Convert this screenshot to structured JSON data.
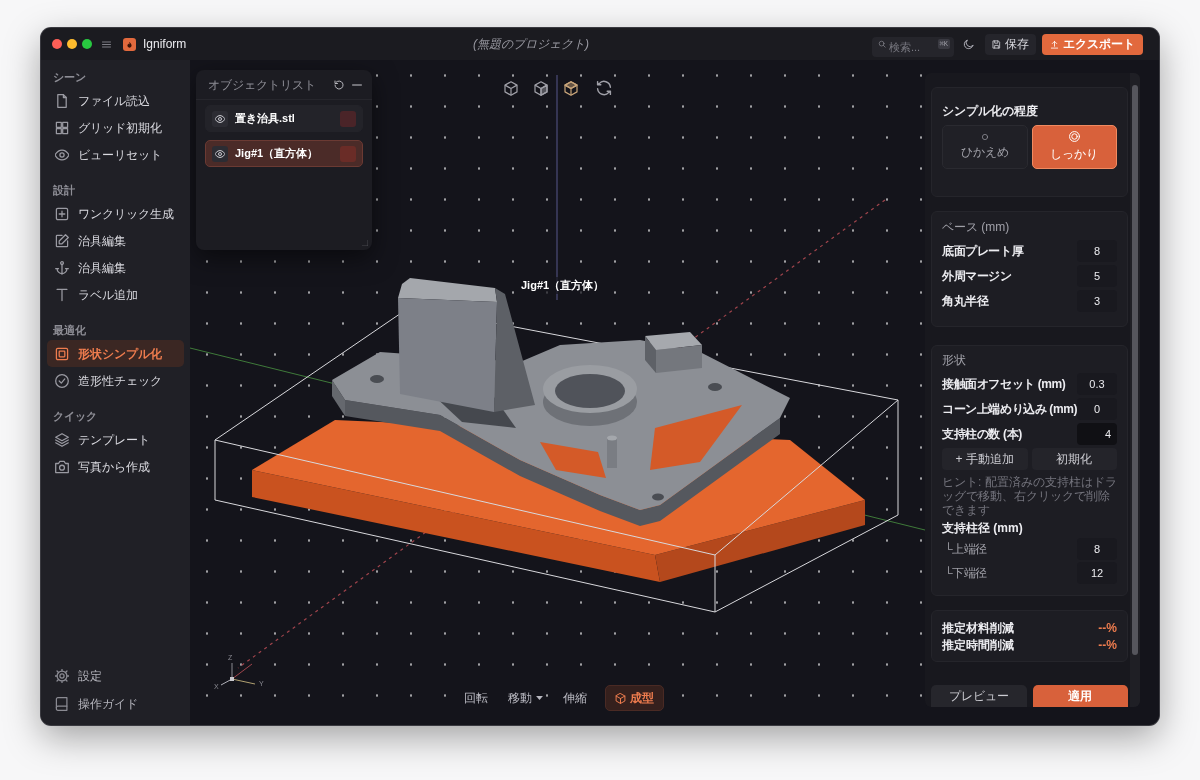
{
  "titlebar": {
    "app_name": "Igniform",
    "project_title": "(無題のプロジェクト)",
    "search": {
      "placeholder": "検索...",
      "shortcut": "⌘K"
    },
    "buttons": [
      {
        "label": "保存",
        "kind": "plain"
      },
      {
        "label": "エクスポート",
        "kind": "primary"
      }
    ]
  },
  "sidebar": {
    "sections": [
      {
        "title": "シーン",
        "items": [
          {
            "label": "ファイル読込",
            "selected": false
          },
          {
            "label": "グリッド初期化",
            "selected": false
          },
          {
            "label": "ビューリセット",
            "selected": false
          }
        ]
      },
      {
        "title": "設計",
        "items": [
          {
            "label": "ワンクリック生成",
            "selected": false
          },
          {
            "label": "治具編集",
            "selected": false
          },
          {
            "label": "治具編集",
            "selected": false
          },
          {
            "label": "ラベル追加",
            "selected": false
          }
        ]
      },
      {
        "title": "最適化",
        "items": [
          {
            "label": "形状シンプル化",
            "selected": true
          },
          {
            "label": "造形性チェック",
            "selected": false
          }
        ]
      },
      {
        "title": "クイック",
        "items": [
          {
            "label": "テンプレート",
            "selected": false
          },
          {
            "label": "写真から作成",
            "selected": false
          }
        ]
      }
    ],
    "footer_items": [
      {
        "label": "設定"
      },
      {
        "label": "操作ガイド"
      }
    ]
  },
  "object_list": {
    "title": "オブジェクトリスト",
    "items": [
      {
        "name": "置き治具.stl",
        "visible": true,
        "selected": false,
        "color": "#4a2428"
      },
      {
        "name": "Jig#1（直方体）",
        "visible": true,
        "selected": true,
        "color": "#6a2c27"
      }
    ]
  },
  "viewport": {
    "view_presets": [
      {
        "selected": false
      },
      {
        "selected": false
      },
      {
        "selected": true
      }
    ],
    "object_label": "Jig#1（直方体）",
    "axis_labels": [
      "X",
      "Y",
      "Z"
    ],
    "tools": [
      {
        "label": "回転",
        "selected": false,
        "dropdown": false
      },
      {
        "label": "移動",
        "selected": false,
        "dropdown": true
      },
      {
        "label": "伸縮",
        "selected": false,
        "dropdown": false
      },
      {
        "label": "成型",
        "selected": true,
        "dropdown": false
      }
    ]
  },
  "properties": {
    "simplify": {
      "title": "シンプル化の程度",
      "options": [
        {
          "label": "ひかえめ",
          "selected": false
        },
        {
          "label": "しっかり",
          "selected": true
        }
      ]
    },
    "base": {
      "title": "ベース (mm)",
      "fields": [
        {
          "label": "底面プレート厚",
          "value": "8",
          "kind": "box"
        },
        {
          "label": "外周マージン",
          "value": "5",
          "kind": "box"
        },
        {
          "label": "角丸半径",
          "value": "3",
          "kind": "box"
        }
      ]
    },
    "shape": {
      "title": "形状",
      "fields": [
        {
          "label": "接触面オフセット (mm)",
          "value": "0.3",
          "kind": "box"
        },
        {
          "label": "コーン上端めり込み (mm)",
          "value": "0",
          "kind": "box"
        },
        {
          "label": "支持柱の数 (本)",
          "value": "4",
          "kind": "spin"
        }
      ],
      "buttons": [
        "+ 手動追加",
        "初期化"
      ],
      "hint": "ヒント: 配置済みの支持柱はドラッグで移動、右クリックで削除できます",
      "diameter": {
        "title": "支持柱径 (mm)",
        "fields": [
          {
            "label": "└上端径",
            "value": "8",
            "kind": "box"
          },
          {
            "label": "└下端径",
            "value": "12",
            "kind": "box"
          }
        ]
      }
    },
    "estimates": [
      {
        "label": "推定材料削減",
        "value": "--%"
      },
      {
        "label": "推定時間削減",
        "value": "--%"
      }
    ],
    "actions": [
      {
        "label": "プレビュー",
        "kind": "secondary"
      },
      {
        "label": "適用",
        "kind": "primary"
      }
    ]
  }
}
